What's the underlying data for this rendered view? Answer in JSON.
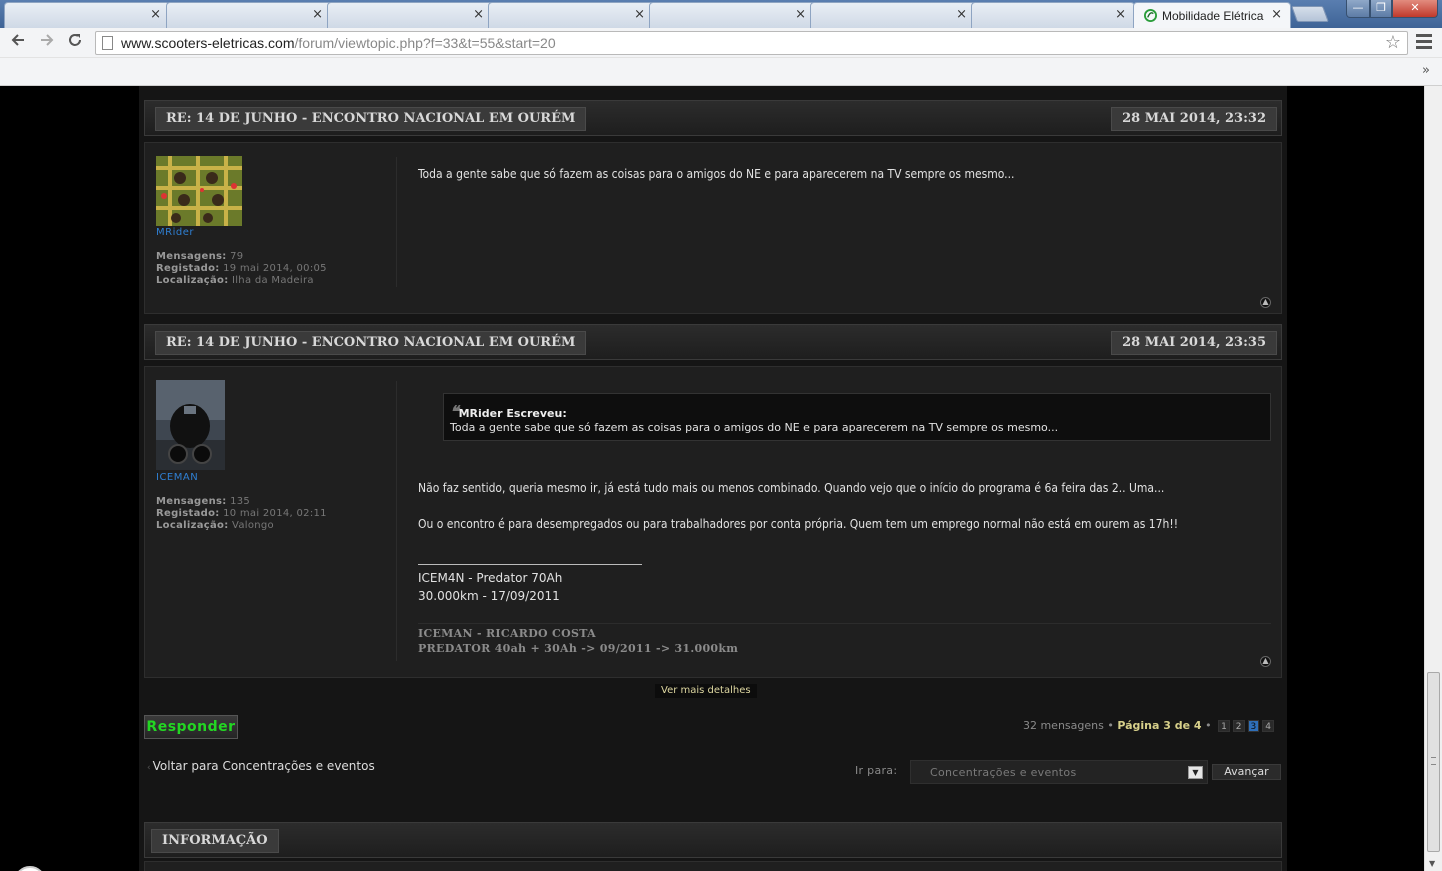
{
  "browser": {
    "tabs": [
      {
        "title": "",
        "close": "×"
      },
      {
        "title": "",
        "close": "×"
      },
      {
        "title": "",
        "close": "×"
      },
      {
        "title": "",
        "close": "×"
      },
      {
        "title": "",
        "close": "×"
      },
      {
        "title": "",
        "close": "×"
      },
      {
        "title": "",
        "close": "×"
      },
      {
        "title": "Mobilidade Elétrica",
        "close": "×",
        "active": true
      }
    ],
    "window_buttons": {
      "minimize": "—",
      "maximize": "❐",
      "close": "✕"
    },
    "url_host": "www.scooters-eletricas.com",
    "url_path": "/forum/viewtopic.php?f=33&t=55&start=20",
    "bookmarks_chevron": "»",
    "accent": "#4f74a8"
  },
  "posts": [
    {
      "title": "RE: 14 DE JUNHO - ENCONTRO NACIONAL EM OURÉM",
      "date": "28 MAI 2014, 23:32",
      "author": "MRider",
      "messages_label": "Mensagens:",
      "messages": "79",
      "registered_label": "Registado:",
      "registered": "19 mai 2014, 00:05",
      "location_label": "Localização:",
      "location": "Ilha da Madeira",
      "text": "Toda a gente sabe que só fazem as coisas para o amigos do NE e para aparecerem na TV sempre os mesmo...",
      "top_icon": "▲"
    },
    {
      "title": "RE: 14 DE JUNHO - ENCONTRO NACIONAL EM OURÉM",
      "date": "28 MAI 2014, 23:35",
      "author": "ICEMAN",
      "messages_label": "Mensagens:",
      "messages": "135",
      "registered_label": "Registado:",
      "registered": "10 mai 2014, 02:11",
      "location_label": "Localização:",
      "location": "Valongo",
      "quote_author": "MRider Escreveu:",
      "quote_mark": "❝",
      "quote_text": "Toda a gente sabe que só fazem as coisas para o amigos do NE e para aparecerem na TV sempre os mesmo...",
      "paragraph1": "Não faz sentido, queria mesmo ir, já está tudo mais ou menos combinado. Quando vejo que o início do programa é 6a feira das 2.. Uma...",
      "paragraph2": "Ou o encontro é para desempregados ou para trabalhadores por conta própria. Quem tem um emprego normal não está em ourem as 17h!!",
      "sig_line1": "ICEM4N - Predator 70Ah",
      "sig_line2": "30.000km - 17/09/2011",
      "sig2_line1": "ICEMAN - RICARDO COSTA",
      "sig2_line2": "PREDATOR 40ah + 30Ah -> 09/2011 -> 31.000km",
      "top_icon": "▲"
    }
  ],
  "more_details": "Ver mais detalhes",
  "reply_label": "Responder",
  "pagination": {
    "count": "32 mensagens",
    "bullet": "•",
    "current": "Página 3 de 4",
    "pages": [
      "1",
      "2",
      "3",
      "4"
    ],
    "active_page": "3"
  },
  "back_link": {
    "arrow": "‹",
    "label": "Voltar para Concentrações e eventos"
  },
  "jump": {
    "label": "Ir para:",
    "selected": "Concentrações e eventos",
    "arrow": "▼",
    "go_label": "Avançar"
  },
  "info_title": "INFORMAÇÃO",
  "colors": {
    "link_blue": "#2f7fd2",
    "reply_green": "#23d623",
    "page_active": "#2f6fb8"
  }
}
